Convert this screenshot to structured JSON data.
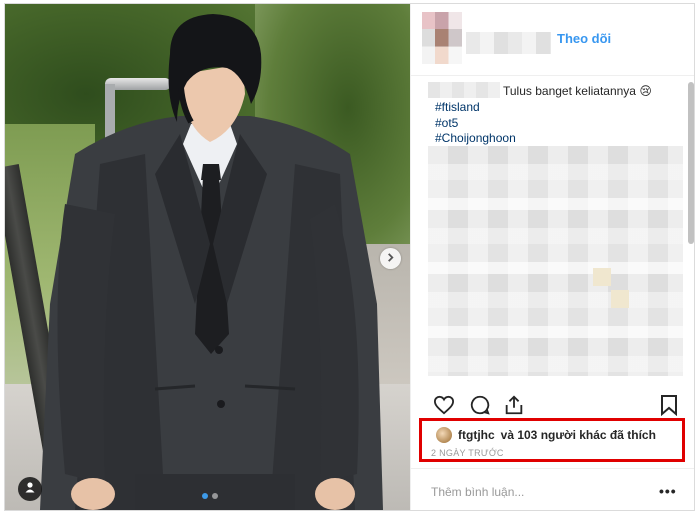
{
  "header": {
    "follow_label": "Theo dõi"
  },
  "caption": {
    "text": "Tulus banget keliatannya 😢",
    "hashtags": [
      "#ftisland",
      "#ot5",
      "#Choijonghoon"
    ]
  },
  "likes": {
    "username": "ftgtjhc",
    "text": "và 103 người khác đã thích"
  },
  "timestamp": "2 NGÀY TRƯỚC",
  "comment": {
    "placeholder": "Thêm bình luận..."
  },
  "more_label": "•••",
  "carousel": {
    "pages": 2,
    "current": 1
  },
  "colors": {
    "link": "#3897f0",
    "hashtag": "#003569",
    "highlight": "#e00000",
    "carousel_active": "#3d9ae8"
  },
  "icons": [
    "chevron-right-icon",
    "user-tag-icon",
    "heart-icon",
    "comment-icon",
    "share-icon",
    "bookmark-icon",
    "more-icon"
  ]
}
